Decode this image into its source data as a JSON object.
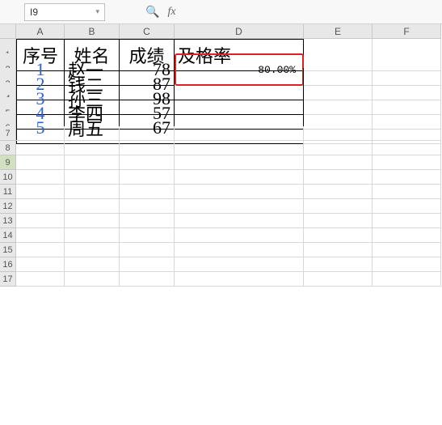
{
  "namebox": {
    "value": "I9"
  },
  "columns": [
    "A",
    "B",
    "C",
    "D",
    "E",
    "F"
  ],
  "headers": {
    "A": "序号",
    "B": "姓名",
    "C": "成绩",
    "D": "及格率"
  },
  "rows": [
    {
      "n": 1,
      "A": "1",
      "B": "赵一",
      "C": "78",
      "D": "80.00%"
    },
    {
      "n": 2,
      "A": "2",
      "B": "钱二",
      "C": "87"
    },
    {
      "n": 3,
      "A": "3",
      "B": "孙三",
      "C": "98"
    },
    {
      "n": 4,
      "A": "4",
      "B": "李四",
      "C": "57"
    },
    {
      "n": 5,
      "A": "5",
      "B": "周五",
      "C": "67"
    }
  ],
  "row_labels": [
    "1",
    "2",
    "3",
    "4",
    "5",
    "6",
    "7",
    "8",
    "9",
    "10",
    "11",
    "12",
    "13",
    "14",
    "15",
    "16",
    "17"
  ],
  "chart_data": {
    "type": "table",
    "title": "",
    "columns": [
      "序号",
      "姓名",
      "成绩",
      "及格率"
    ],
    "data": [
      [
        1,
        "赵一",
        78,
        "80.00%"
      ],
      [
        2,
        "钱二",
        87,
        null
      ],
      [
        3,
        "孙三",
        98,
        null
      ],
      [
        4,
        "李四",
        57,
        null
      ],
      [
        5,
        "周五",
        67,
        null
      ]
    ]
  }
}
